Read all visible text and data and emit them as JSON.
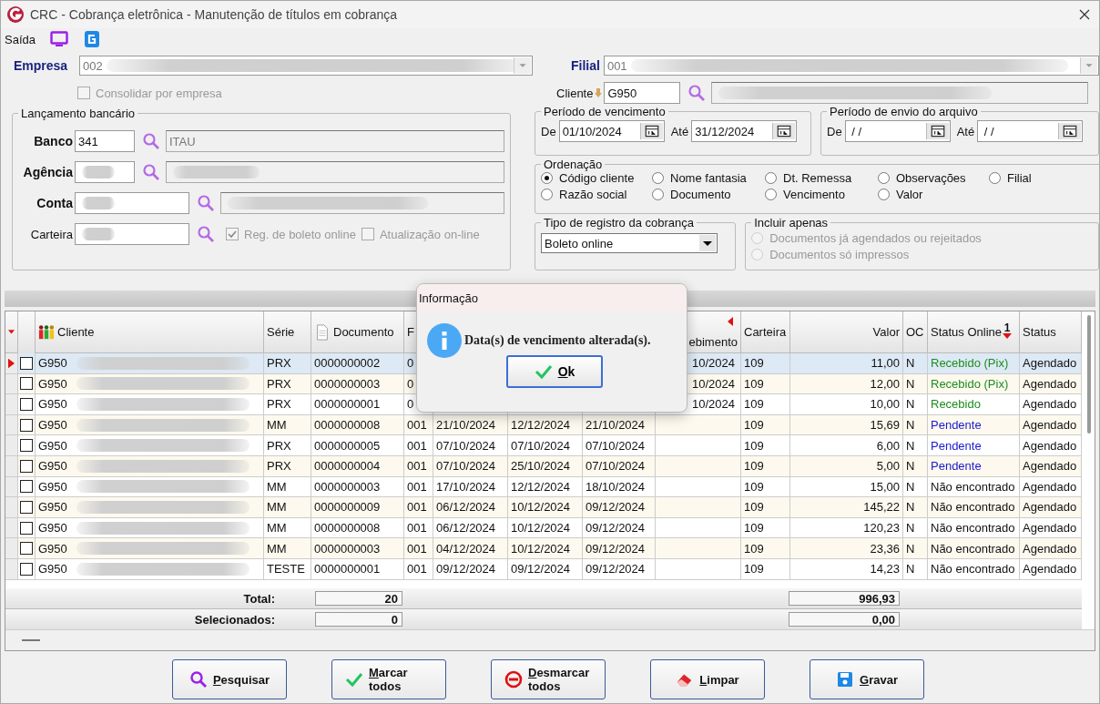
{
  "window": {
    "title": "CRC - Cobrança eletrônica - Manutenção de títulos em cobrança"
  },
  "toolbar": {
    "label": "Saída"
  },
  "empresa": {
    "label": "Empresa",
    "code": "002",
    "blurred": true
  },
  "consolidar": {
    "label": "Consolidar por empresa",
    "checked": false,
    "disabled": true
  },
  "filial": {
    "label": "Filial",
    "code": "001",
    "blurred": true
  },
  "cliente": {
    "label": "Cliente",
    "value": "G950",
    "blurred": true
  },
  "lancamento": {
    "title": "Lançamento bancário",
    "fields": [
      {
        "label": "Banco",
        "value": "341",
        "description": "ITAU",
        "bold": true,
        "blurred": false,
        "wide": false
      },
      {
        "label": "Agência",
        "bold": true,
        "blurred": true,
        "wide": false
      },
      {
        "label": "Conta",
        "bold": true,
        "blurred": true,
        "wide": true
      },
      {
        "label": "Carteira",
        "bold": false,
        "blurred": true,
        "wide": true
      }
    ],
    "options": [
      {
        "label": "Reg. de boleto online",
        "checked": true
      },
      {
        "label": "Atualização on-line",
        "checked": false
      }
    ]
  },
  "vencimento": {
    "title": "Período de vencimento",
    "from_label": "De",
    "from": "01/10/2024",
    "to_label": "Até",
    "to": "31/12/2024"
  },
  "envio": {
    "title": "Período de envio do arquivo",
    "from_label": "De",
    "from": " / /",
    "to_label": "Até",
    "to": " / /"
  },
  "ordenacao": {
    "title": "Ordenação",
    "options": [
      {
        "label": "Código cliente",
        "selected": true
      },
      {
        "label": "Nome fantasia",
        "selected": false
      },
      {
        "label": "Dt. Remessa",
        "selected": false
      },
      {
        "label": "Observações",
        "selected": false
      },
      {
        "label": "Filial",
        "selected": false
      },
      {
        "label": "Razão social",
        "selected": false
      },
      {
        "label": "Documento",
        "selected": false
      },
      {
        "label": "Vencimento",
        "selected": false
      },
      {
        "label": "Valor",
        "selected": false
      }
    ]
  },
  "tipo_registro": {
    "title": "Tipo de registro da cobrança",
    "value": "Boleto online"
  },
  "incluir": {
    "title": "Incluir apenas",
    "disabled": true,
    "options": [
      {
        "label": "Documentos já agendados ou rejeitados",
        "selected": false
      },
      {
        "label": "Documentos só impressos",
        "selected": false
      }
    ]
  },
  "grid": {
    "headers": {
      "cliente": "Cliente",
      "serie": "Série",
      "documento": "Documento",
      "filial": "F",
      "column_10": "ebimento",
      "carteira": "Carteira",
      "valor": "Valor",
      "oc": "OC",
      "status_online": "Status Online",
      "status": "Status"
    },
    "sort_rank": "1",
    "rows": [
      {
        "selected": true,
        "checked": false,
        "cliente": "G950",
        "filial": "0",
        "column_10": "10/2024",
        "carteira": "109",
        "valor": "11,00",
        "oc": "N",
        "status_online": "Recebido (Pix)",
        "color": "#1e8c1e",
        "status": "Agendado",
        "serie": "PRX",
        "documento": "0000000002"
      },
      {
        "selected": false,
        "checked": false,
        "cliente": "G950",
        "filial": "0",
        "column_10": "10/2024",
        "carteira": "109",
        "valor": "12,00",
        "oc": "N",
        "status_online": "Recebido (Pix)",
        "color": "#1e8c1e",
        "status": "Agendado",
        "serie": "PRX",
        "documento": "0000000003"
      },
      {
        "selected": false,
        "checked": false,
        "cliente": "G950",
        "filial": "0",
        "column_10": "10/2024",
        "carteira": "109",
        "valor": "10,00",
        "oc": "N",
        "status_online": "Recebido",
        "color": "#1e8c1e",
        "status": "Agendado",
        "serie": "PRX",
        "documento": "0000000001"
      },
      {
        "selected": false,
        "checked": false,
        "cliente": "G950",
        "serie": "MM",
        "documento": "0000000008",
        "filial": "001",
        "column_7": "21/10/2024",
        "column_8": "12/12/2024",
        "column_9": "21/10/2024",
        "carteira": "109",
        "valor": "15,69",
        "oc": "N",
        "status_online": "Pendente",
        "color": "#1a1ad0",
        "status": "Agendado"
      },
      {
        "selected": false,
        "checked": false,
        "cliente": "G950",
        "serie": "PRX",
        "documento": "0000000005",
        "filial": "001",
        "column_7": "07/10/2024",
        "column_8": "07/10/2024",
        "column_9": "07/10/2024",
        "carteira": "109",
        "valor": "6,00",
        "oc": "N",
        "status_online": "Pendente",
        "color": "#1a1ad0",
        "status": "Agendado"
      },
      {
        "selected": false,
        "checked": false,
        "cliente": "G950",
        "serie": "PRX",
        "documento": "0000000004",
        "filial": "001",
        "column_7": "07/10/2024",
        "column_8": "25/10/2024",
        "column_9": "07/10/2024",
        "carteira": "109",
        "valor": "5,00",
        "oc": "N",
        "status_online": "Pendente",
        "color": "#1a1ad0",
        "status": "Agendado"
      },
      {
        "selected": false,
        "checked": false,
        "cliente": "G950",
        "serie": "MM",
        "documento": "0000000003",
        "filial": "001",
        "column_7": "17/10/2024",
        "column_8": "12/12/2024",
        "column_9": "18/10/2024",
        "carteira": "109",
        "valor": "15,00",
        "oc": "N",
        "status_online": "Não encontrado",
        "color": "#111111",
        "status": "Agendado"
      },
      {
        "selected": false,
        "checked": false,
        "cliente": "G950",
        "serie": "MM",
        "documento": "0000000009",
        "filial": "001",
        "column_7": "06/12/2024",
        "column_8": "10/12/2024",
        "column_9": "09/12/2024",
        "carteira": "109",
        "valor": "145,22",
        "oc": "N",
        "status_online": "Não encontrado",
        "color": "#111111",
        "status": "Agendado"
      },
      {
        "selected": false,
        "checked": false,
        "cliente": "G950",
        "serie": "MM",
        "documento": "0000000008",
        "filial": "001",
        "column_7": "06/12/2024",
        "column_8": "10/12/2024",
        "column_9": "09/12/2024",
        "carteira": "109",
        "valor": "120,23",
        "oc": "N",
        "status_online": "Não encontrado",
        "color": "#111111",
        "status": "Agendado"
      },
      {
        "selected": false,
        "checked": false,
        "cliente": "G950",
        "serie": "MM",
        "documento": "0000000003",
        "filial": "001",
        "column_7": "04/12/2024",
        "column_8": "10/12/2024",
        "column_9": "09/12/2024",
        "carteira": "109",
        "valor": "23,36",
        "oc": "N",
        "status_online": "Não encontrado",
        "color": "#111111",
        "status": "Agendado"
      },
      {
        "selected": false,
        "checked": false,
        "cliente": "G950",
        "serie": "TESTE",
        "documento": "0000000001",
        "filial": "001",
        "column_7": "09/12/2024",
        "column_8": "09/12/2024",
        "column_9": "09/12/2024",
        "carteira": "109",
        "valor": "14,23",
        "oc": "N",
        "status_online": "Não encontrado",
        "color": "#111111",
        "status": "Agendado"
      }
    ],
    "totals": [
      {
        "label": "Total:",
        "count": "20",
        "valor": "996,93"
      },
      {
        "label": "Selecionados:",
        "count": "0",
        "valor": "0,00"
      }
    ]
  },
  "dialog": {
    "title": "Informação",
    "message": "Data(s) de vencimento alterada(s).",
    "button": "Ok"
  },
  "buttons": [
    {
      "label": "Pesquisar",
      "kind": "search"
    },
    {
      "label": "Marcar todos",
      "kind": "check"
    },
    {
      "label": "Desmarcar todos",
      "kind": "forbidden"
    },
    {
      "label": "Limpar",
      "kind": "eraser"
    },
    {
      "label": "Gravar",
      "kind": "save"
    }
  ]
}
